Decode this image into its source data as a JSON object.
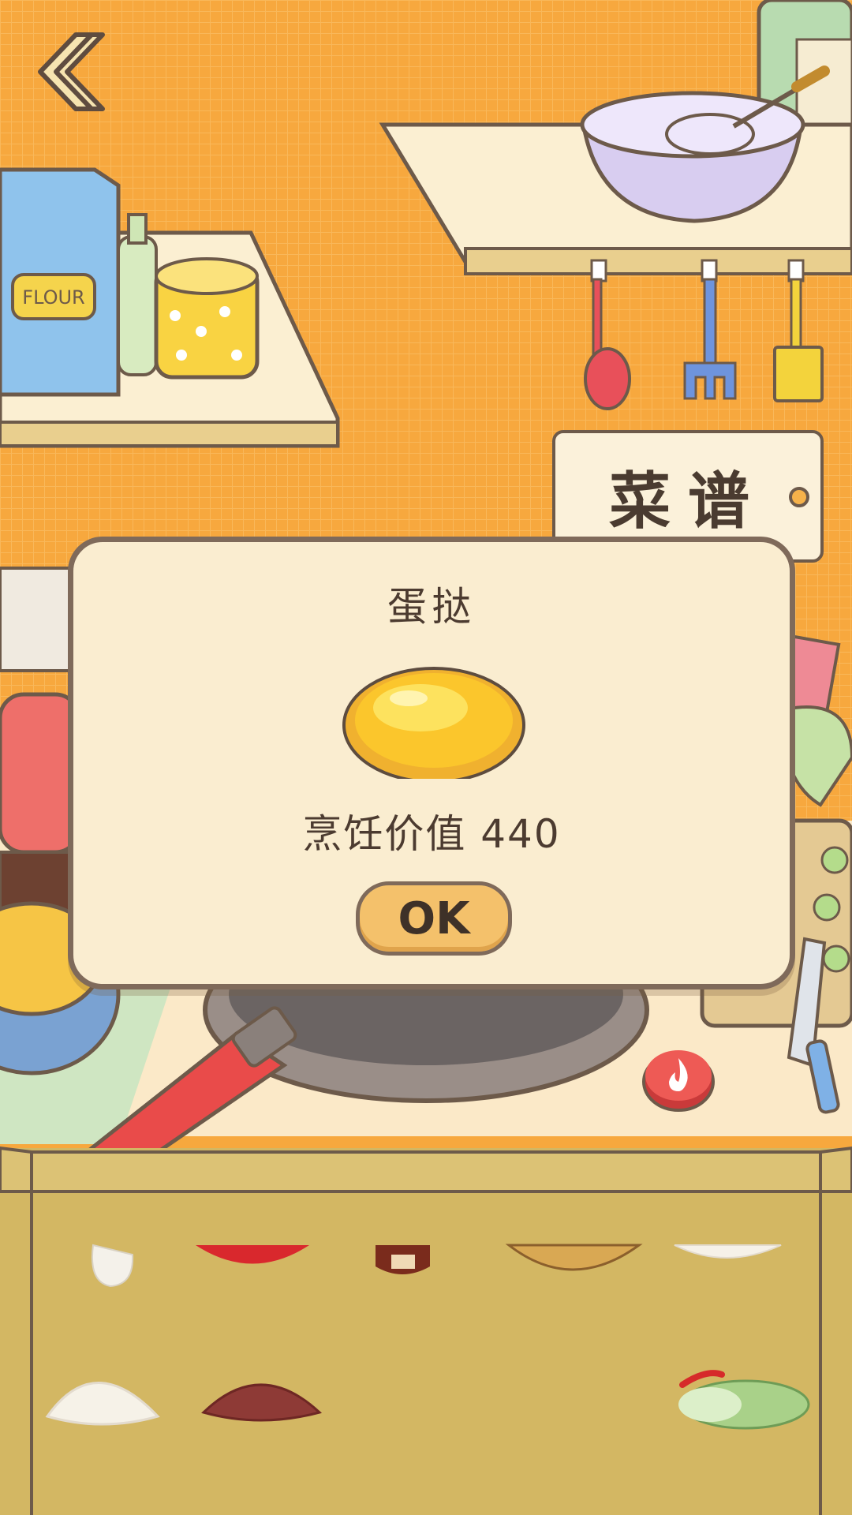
{
  "top": {
    "back_icon": "chevron-left-icon"
  },
  "recipe_tag": {
    "label": "菜谱"
  },
  "stove": {
    "fire_icon": "fire-icon"
  },
  "result_dialog": {
    "dish_name": "蛋挞",
    "dish_icon": "egg-tart-icon",
    "cooking_value_text": "烹饪价值 440",
    "ok_label": "OK"
  },
  "ingredients": {
    "row1": [
      "garlic-clove-icon",
      "tomato-icon",
      "sauce-jar-icon",
      "bread-basket-icon",
      "white-plate-icon"
    ],
    "row2": [
      "dough-icon",
      "minced-meat-icon",
      "",
      "",
      "cabbage-icon"
    ]
  },
  "colors": {
    "wall": "#f7a83e",
    "shelf": "#fbefd2",
    "counter": "#d3b763",
    "dialog": "#faedd0",
    "button": "#f4c16b"
  }
}
